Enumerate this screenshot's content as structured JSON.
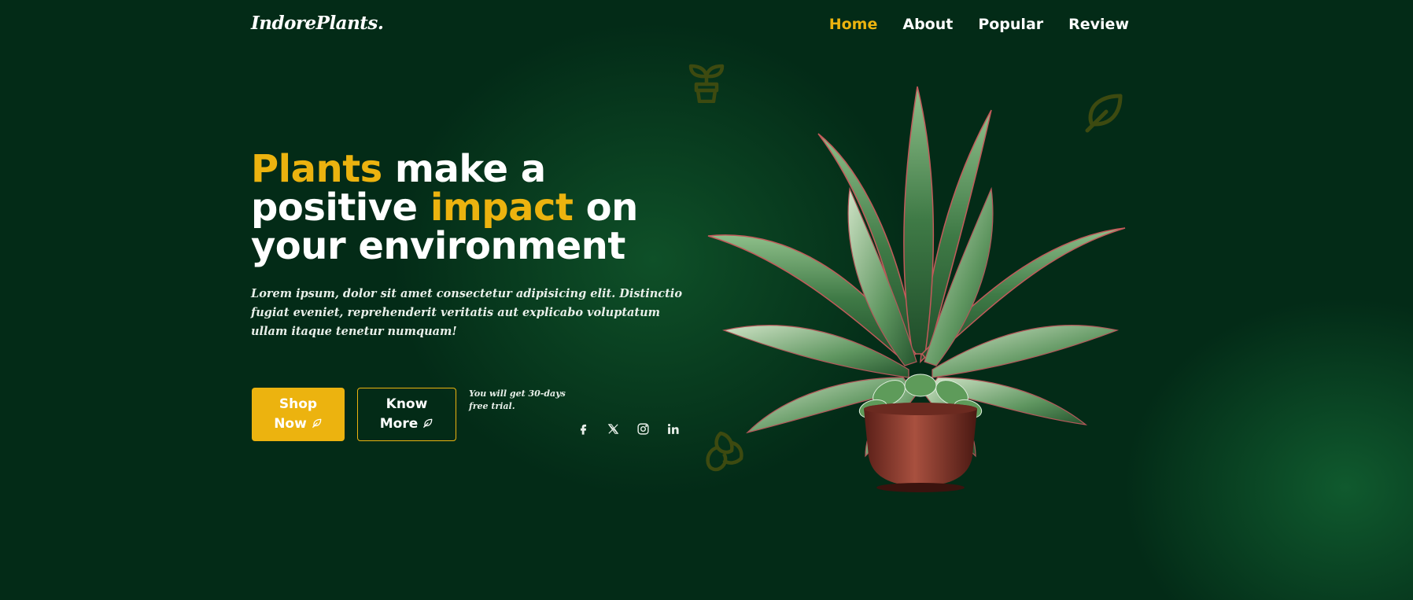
{
  "brand": {
    "logo": "IndorePlants."
  },
  "nav": {
    "items": [
      {
        "label": "Home",
        "active": true
      },
      {
        "label": "About",
        "active": false
      },
      {
        "label": "Popular",
        "active": false
      },
      {
        "label": "Review",
        "active": false
      }
    ]
  },
  "hero": {
    "headline": {
      "word1": "Plants",
      "part2": " make a",
      "part3": "positive ",
      "word2": "impact",
      "part4": " on",
      "part5": "your environment"
    },
    "description": "Lorem ipsum, dolor sit amet consectetur adipisicing elit. Distinctio fugiat eveniet, reprehenderit veritatis aut explicabo voluptatum ullam itaque tenetur numquam!",
    "buttons": {
      "shop_line1": "Shop",
      "shop_line2": "Now",
      "more_line1": "Know",
      "more_line2": "More"
    },
    "trial_note": "You will get 30-days free trial."
  },
  "social": [
    "facebook-icon",
    "x-icon",
    "instagram-icon",
    "linkedin-icon"
  ],
  "icons": {
    "button_icon": "leaf-icon",
    "decorations": [
      "sprout-pot-icon",
      "leaf-icon",
      "flower-icon"
    ]
  },
  "colors": {
    "background": "#032b17",
    "accent": "#ecb30f",
    "text": "#ffffff",
    "deco": "#3d4a10"
  }
}
